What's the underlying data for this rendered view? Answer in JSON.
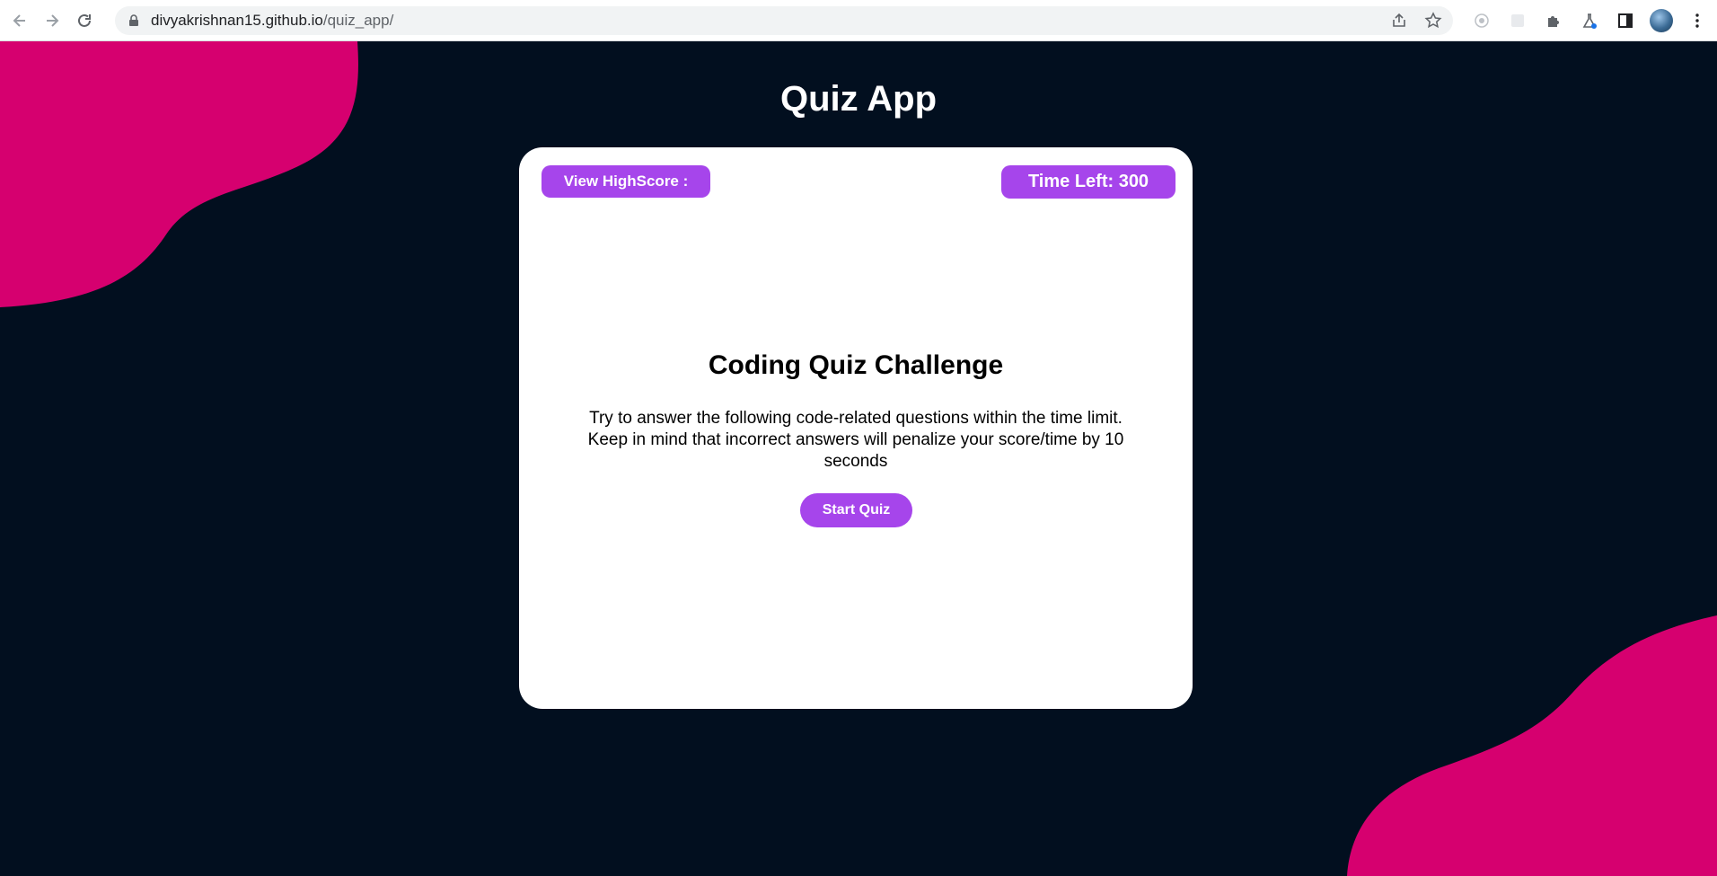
{
  "browser": {
    "url_host": "divyakrishnan15.github.io",
    "url_path": "/quiz_app/",
    "icons": [
      "back-icon",
      "forward-icon",
      "reload-icon",
      "lock-icon",
      "share-icon",
      "bookmark-star-icon",
      "extension-icon",
      "puzzle-icon",
      "labs-flask-icon",
      "side-panel-icon",
      "profile-avatar",
      "kebab-menu-icon"
    ]
  },
  "page": {
    "title": "Quiz App",
    "highscore_label": "View HighScore :",
    "timer_label": "Time Left: 300",
    "heading": "Coding Quiz Challenge",
    "description": "Try to answer the following code-related questions within the time limit. Keep in mind that incorrect answers will penalize your score/time by 10 seconds",
    "start_label": "Start Quiz"
  },
  "colors": {
    "background": "#020f1f",
    "blob": "#d6006f",
    "accent": "#a645eb",
    "card": "#ffffff"
  }
}
